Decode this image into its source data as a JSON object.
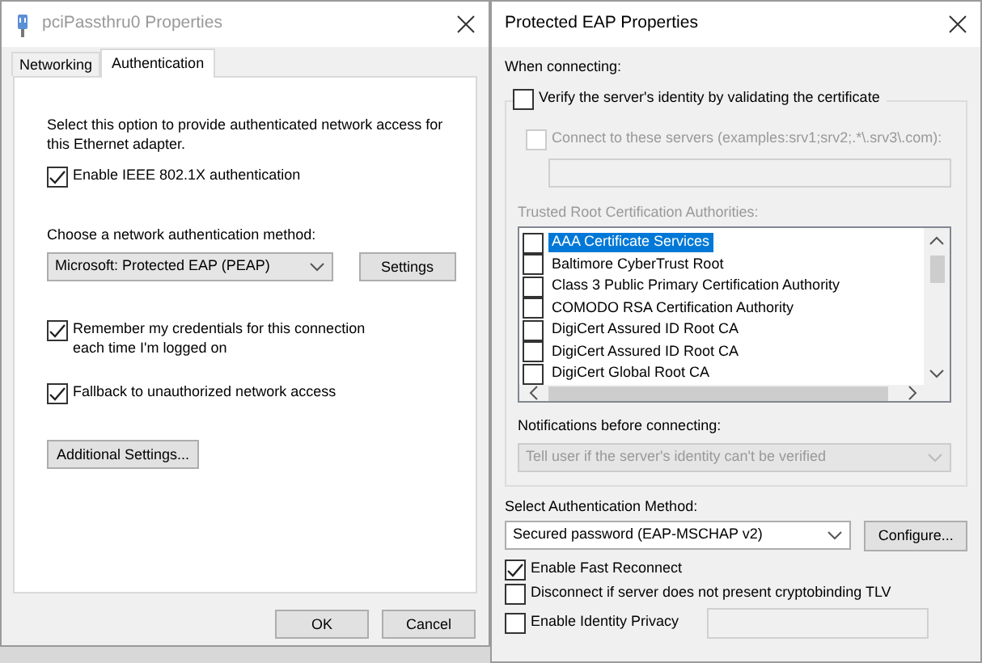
{
  "left_dialog": {
    "title": "pciPassthru0 Properties",
    "tabs": [
      {
        "label": "Networking",
        "selected": false
      },
      {
        "label": "Authentication",
        "selected": true
      }
    ],
    "intro_text": "Select this option to provide authenticated network access for this Ethernet adapter.",
    "enable_8021x": {
      "label": "Enable IEEE 802.1X authentication",
      "checked": true
    },
    "method_label": "Choose a network authentication method:",
    "method_select": {
      "value": "Microsoft: Protected EAP (PEAP)"
    },
    "settings_button": "Settings",
    "remember": {
      "label": "Remember my credentials for this connection each time I'm logged on",
      "checked": true
    },
    "fallback": {
      "label": "Fallback to unauthorized network access",
      "checked": true
    },
    "additional_button": "Additional Settings...",
    "buttons": [
      "OK",
      "Cancel"
    ]
  },
  "right_dialog": {
    "title": "Protected EAP Properties",
    "when_label": "When connecting:",
    "verify": {
      "label": "Verify the server's identity by validating the certificate",
      "checked": false
    },
    "connect": {
      "label": "Connect to these servers (examples:srv1;srv2;.*\\.srv3\\.com):",
      "checked": false,
      "disabled": true
    },
    "servers_field": {
      "disabled": true
    },
    "trusted_label": {
      "text": "Trusted Root Certification Authorities:",
      "disabled": true
    },
    "authorities": [
      {
        "label": "AAA Certificate Services",
        "checked": false,
        "selected": true
      },
      {
        "label": "Baltimore CyberTrust Root",
        "checked": false,
        "selected": false
      },
      {
        "label": "Class 3 Public Primary Certification Authority",
        "checked": false,
        "selected": false
      },
      {
        "label": "COMODO RSA Certification Authority",
        "checked": false,
        "selected": false
      },
      {
        "label": "DigiCert Assured ID Root CA",
        "checked": false,
        "selected": false
      },
      {
        "label": "DigiCert Assured ID Root CA",
        "checked": false,
        "selected": false
      },
      {
        "label": "DigiCert Global Root CA",
        "checked": false,
        "selected": false
      }
    ],
    "notifications_label": "Notifications before connecting:",
    "notifications_select": {
      "value": "Tell user if the server's identity can't be verified",
      "disabled": true
    },
    "method_label": "Select Authentication Method:",
    "method_select": {
      "value": "Secured password (EAP-MSCHAP v2)"
    },
    "configure_button": "Configure...",
    "options": [
      {
        "label": "Enable Fast Reconnect",
        "checked": true
      },
      {
        "label": "Disconnect if server does not present cryptobinding TLV",
        "checked": false
      },
      {
        "label": "Enable Identity Privacy",
        "checked": false
      }
    ],
    "identity_field": {
      "disabled": true
    }
  }
}
